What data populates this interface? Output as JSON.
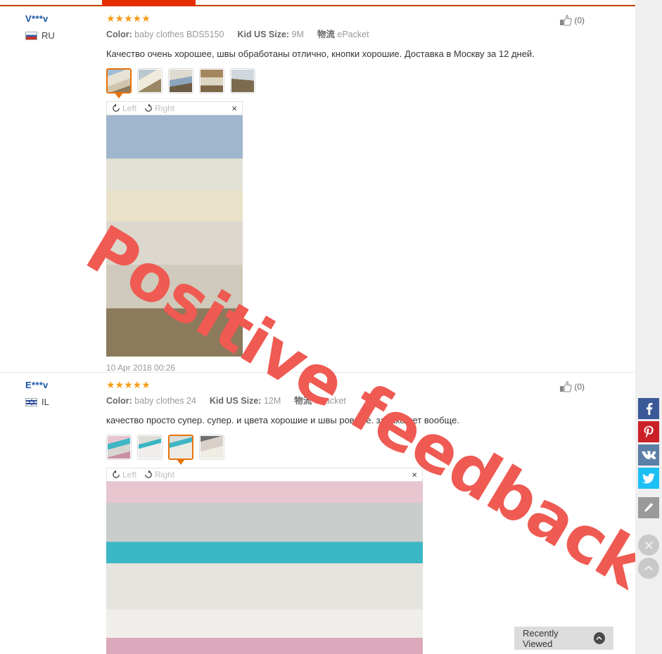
{
  "tabstrip": {
    "active_tab_label": ""
  },
  "watermark": {
    "text": "Positive feedback",
    "color": "#ef5a52"
  },
  "reviews": [
    {
      "buyer_name": "V***v",
      "country_code": "RU",
      "country_flag": "flag-ru-icon",
      "stars": "★★★★★",
      "rating": 5,
      "attr_color_label": "Color:",
      "attr_color_value": "baby clothes BDS5150",
      "attr_size_label": "Kid US Size:",
      "attr_size_value": "9M",
      "logistics_label": "物流",
      "logistics_value": "ePacket",
      "text": "Качество очень хорошее, швы обработаны отлично, кнопки хорошие. Доставка в Москву за 12 дней.",
      "thumbnails": [
        {
          "name": "thumbnail-1",
          "selected": true
        },
        {
          "name": "thumbnail-2",
          "selected": false
        },
        {
          "name": "thumbnail-3",
          "selected": false
        },
        {
          "name": "thumbnail-4",
          "selected": false
        },
        {
          "name": "thumbnail-5",
          "selected": false
        }
      ],
      "rotate_left_label": "Left",
      "rotate_right_label": "Right",
      "close_label": "×",
      "date": "10 Apr 2018 00:26",
      "helpful_count": "(0)"
    },
    {
      "buyer_name": "E***v",
      "country_code": "IL",
      "country_flag": "flag-il-icon",
      "stars": "★★★★★",
      "rating": 5,
      "attr_color_label": "Color:",
      "attr_color_value": "baby clothes 24",
      "attr_size_label": "Kid US Size:",
      "attr_size_value": "12M",
      "logistics_label": "物流",
      "logistics_value": "ePacket",
      "text": "качество просто супер. супер. и цвета хорошие и швы ровные. запаха нет вообще.",
      "thumbnails": [
        {
          "name": "thumbnail-1",
          "selected": false
        },
        {
          "name": "thumbnail-2",
          "selected": false
        },
        {
          "name": "thumbnail-3",
          "selected": true
        },
        {
          "name": "thumbnail-4",
          "selected": false
        }
      ],
      "rotate_left_label": "Left",
      "rotate_right_label": "Right",
      "close_label": "×",
      "date": "",
      "helpful_count": "(0)"
    }
  ],
  "social_rail": [
    {
      "name": "facebook-share-button",
      "glyph": "f",
      "color": "#3b5998"
    },
    {
      "name": "pinterest-share-button",
      "glyph": "P",
      "color": "#cb2027"
    },
    {
      "name": "vk-share-button",
      "glyph": "VK",
      "color": "#5b7fa6"
    },
    {
      "name": "twitter-share-button",
      "glyph": "t",
      "color": "#1dc0f4"
    },
    {
      "name": "edit-feedback-button",
      "glyph": "✎",
      "color": "#9a9a9a"
    }
  ],
  "rail_controls": [
    {
      "name": "close-rail-button",
      "glyph": "✕"
    },
    {
      "name": "scroll-to-top-button",
      "glyph": "︿"
    }
  ],
  "recently_viewed": {
    "label": "Recently Viewed",
    "chevron": "chevron-up-icon"
  }
}
